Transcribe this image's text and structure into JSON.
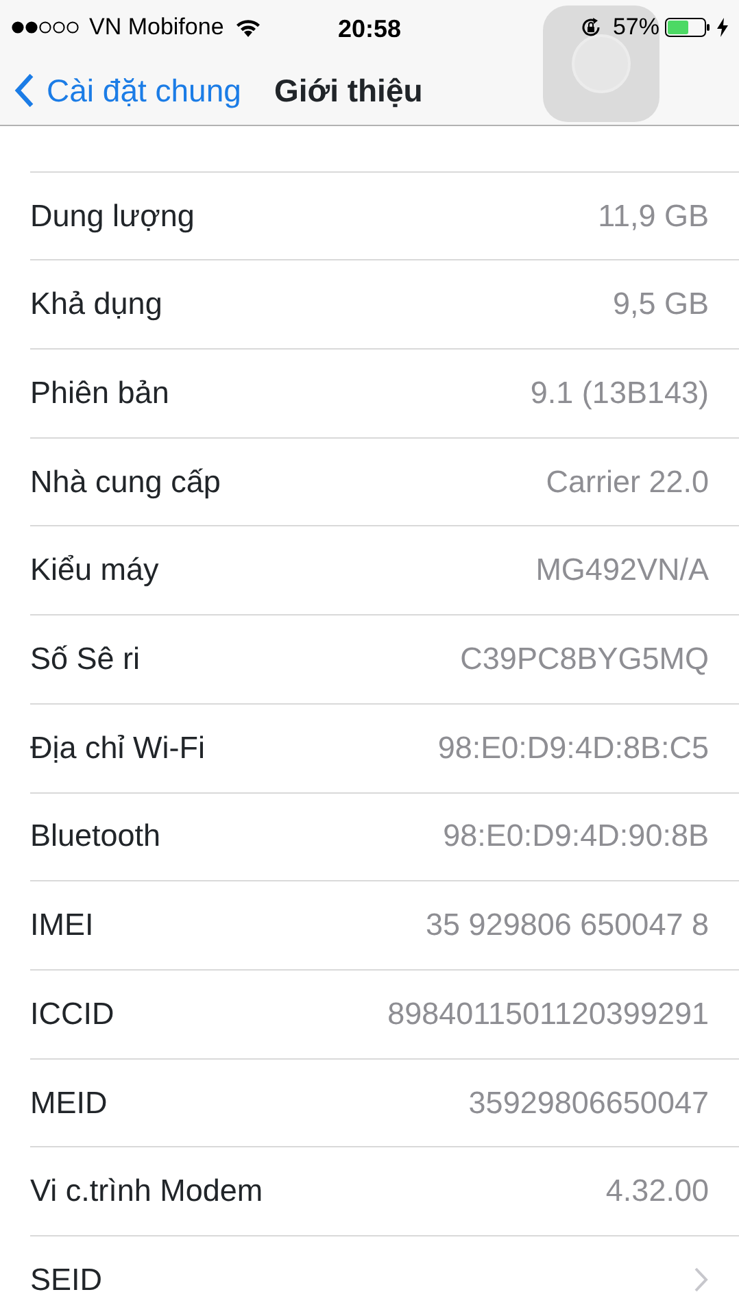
{
  "status_bar": {
    "carrier": "VN Mobifone",
    "time": "20:58",
    "battery": "57%"
  },
  "nav": {
    "back": "Cài đặt chung",
    "title": "Giới thiệu"
  },
  "rows": [
    {
      "kind": "value",
      "label": "Dung lượng",
      "value": "11,9 GB"
    },
    {
      "kind": "value",
      "label": "Khả dụng",
      "value": "9,5 GB"
    },
    {
      "kind": "value",
      "label": "Phiên bản",
      "value": "9.1 (13B143)"
    },
    {
      "kind": "value",
      "label": "Nhà cung cấp",
      "value": "Carrier 22.0"
    },
    {
      "kind": "value",
      "label": "Kiểu máy",
      "value": "MG492VN/A"
    },
    {
      "kind": "value",
      "label": "Số Sê ri",
      "value": "C39PC8BYG5MQ"
    },
    {
      "kind": "value",
      "label": "Địa chỉ Wi-Fi",
      "value": "98:E0:D9:4D:8B:C5"
    },
    {
      "kind": "value",
      "label": "Bluetooth",
      "value": "98:E0:D9:4D:90:8B"
    },
    {
      "kind": "value",
      "label": "IMEI",
      "value": "35 929806 650047 8"
    },
    {
      "kind": "value",
      "label": "ICCID",
      "value": "8984011501120399291"
    },
    {
      "kind": "value",
      "label": "MEID",
      "value": "35929806650047"
    },
    {
      "kind": "value",
      "label": "Vi c.trình Modem",
      "value": "4.32.00"
    },
    {
      "kind": "disclosure",
      "label": "SEID"
    }
  ]
}
